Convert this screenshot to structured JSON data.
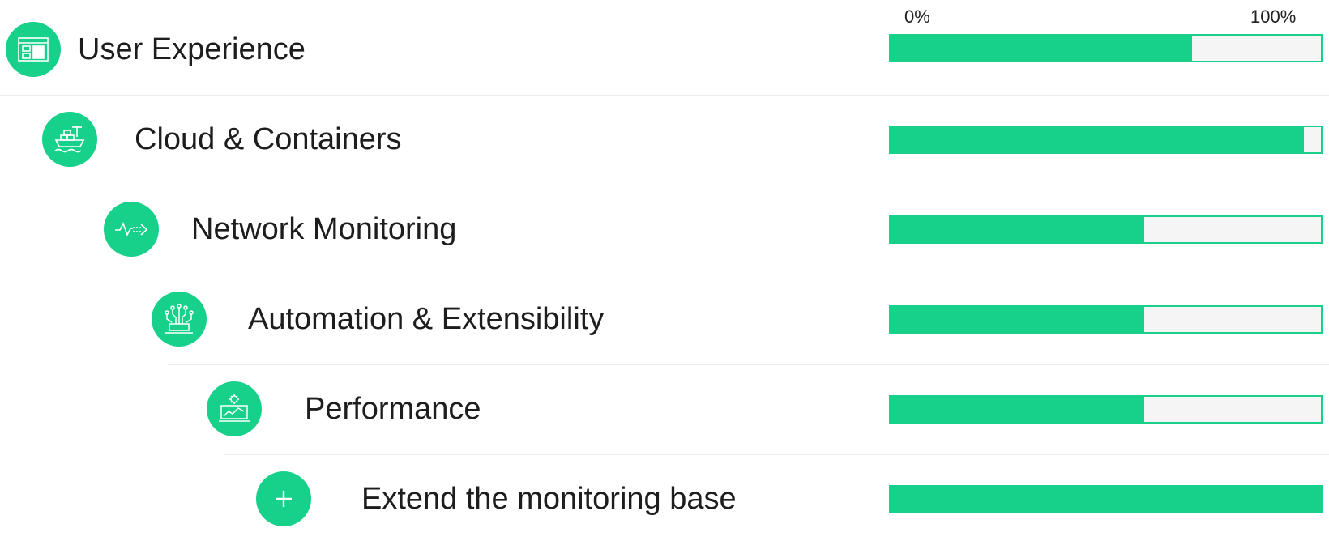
{
  "scale": {
    "min_label": "0%",
    "max_label": "100%"
  },
  "colors": {
    "accent": "#17d18a",
    "track": "#f5f5f5",
    "divider": "#ececec"
  },
  "items": [
    {
      "label": "User Experience",
      "icon": "browser-window-icon",
      "progress": 0.7
    },
    {
      "label": "Cloud & Containers",
      "icon": "container-ship-icon",
      "progress": 0.96
    },
    {
      "label": "Network Monitoring",
      "icon": "network-pulse-icon",
      "progress": 0.59
    },
    {
      "label": "Automation & Extensibility",
      "icon": "circuit-chip-icon",
      "progress": 0.59
    },
    {
      "label": "Performance",
      "icon": "performance-chart-icon",
      "progress": 0.59
    },
    {
      "label": "Extend the monitoring base",
      "icon": "plus-icon",
      "progress": 1.0
    }
  ]
}
